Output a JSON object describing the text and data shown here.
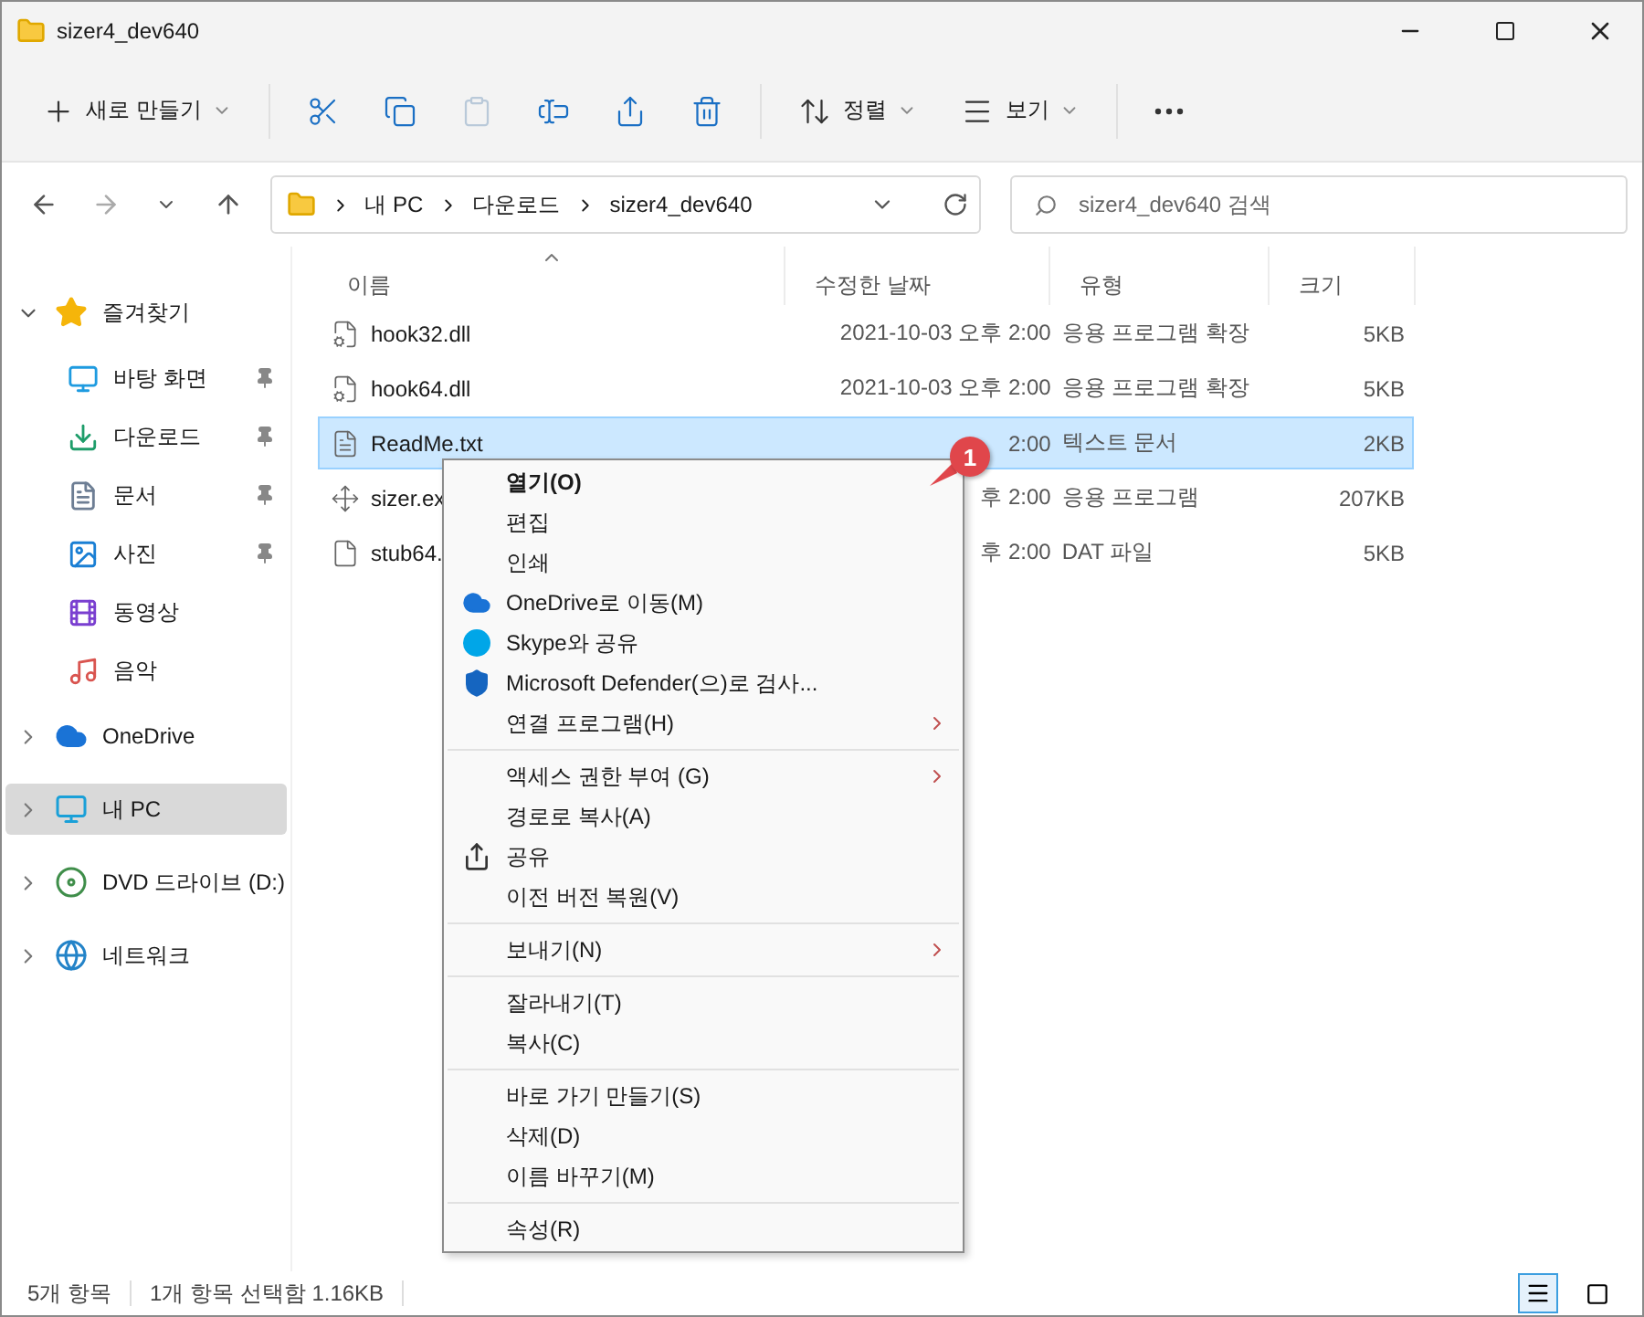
{
  "window": {
    "title": "sizer4_dev640"
  },
  "toolbar": [
    {
      "kind": "labeled",
      "label": "새로 만들기",
      "disabled": false
    },
    {
      "kind": "icon",
      "disabled": false
    },
    {
      "kind": "icon",
      "disabled": false
    },
    {
      "kind": "icon",
      "disabled": true
    },
    {
      "kind": "icon",
      "disabled": false
    },
    {
      "kind": "icon",
      "disabled": false
    },
    {
      "kind": "icon",
      "disabled": false
    },
    {
      "kind": "labeled",
      "label": "정렬",
      "disabled": false
    },
    {
      "kind": "labeled",
      "label": "보기",
      "disabled": false
    },
    {
      "kind": "icon",
      "disabled": false
    }
  ],
  "address": {
    "crumbs": [
      "내 PC",
      "다운로드",
      "sizer4_dev640"
    ]
  },
  "search": {
    "placeholder": "sizer4_dev640 검색"
  },
  "sidebar": [
    {
      "label": "즐겨찾기",
      "expanded": true,
      "selected": false,
      "children": [
        {
          "label": "바탕 화면",
          "pinned": true
        },
        {
          "label": "다운로드",
          "pinned": true
        },
        {
          "label": "문서",
          "pinned": true
        },
        {
          "label": "사진",
          "pinned": true
        },
        {
          "label": "동영상",
          "pinned": false
        },
        {
          "label": "음악",
          "pinned": false
        }
      ]
    },
    {
      "label": "OneDrive",
      "expanded": false,
      "selected": false
    },
    {
      "label": "내 PC",
      "expanded": false,
      "selected": true
    },
    {
      "label": "DVD 드라이브 (D:)",
      "expanded": false,
      "selected": false
    },
    {
      "label": "네트워크",
      "expanded": false,
      "selected": false
    }
  ],
  "table": {
    "columns": [
      {
        "label": "이름",
        "sorted": true
      },
      {
        "label": "수정한 날짜",
        "sorted": false
      },
      {
        "label": "유형",
        "sorted": false
      },
      {
        "label": "크기",
        "sorted": false
      }
    ],
    "rows": [
      {
        "name": "hook32.dll",
        "date": "2021-10-03 오후 2:00",
        "type": "응용 프로그램 확장",
        "size": "5KB",
        "selected": false
      },
      {
        "name": "hook64.dll",
        "date": "2021-10-03 오후 2:00",
        "type": "응용 프로그램 확장",
        "size": "5KB",
        "selected": false
      },
      {
        "name": "ReadMe.txt",
        "date": "2:00",
        "type": "텍스트 문서",
        "size": "2KB",
        "selected": true
      },
      {
        "name": "sizer.ex",
        "date": "후 2:00",
        "type": "응용 프로그램",
        "size": "207KB",
        "selected": false
      },
      {
        "name": "stub64.",
        "date": "후 2:00",
        "type": "DAT 파일",
        "size": "5KB",
        "selected": false
      }
    ]
  },
  "context_menu": [
    [
      {
        "label": "열기(O)",
        "default": true,
        "submenu": false
      },
      {
        "label": "편집",
        "default": false,
        "submenu": false
      },
      {
        "label": "인쇄",
        "default": false,
        "submenu": false
      },
      {
        "label": "OneDrive로 이동(M)",
        "default": false,
        "submenu": false
      },
      {
        "label": "Skype와 공유",
        "default": false,
        "submenu": false
      },
      {
        "label": "Microsoft Defender(으)로 검사...",
        "default": false,
        "submenu": false
      },
      {
        "label": "연결 프로그램(H)",
        "default": false,
        "submenu": true
      }
    ],
    [
      {
        "label": "액세스 권한 부여 (G)",
        "default": false,
        "submenu": true
      },
      {
        "label": "경로로 복사(A)",
        "default": false,
        "submenu": false
      },
      {
        "label": "공유",
        "default": false,
        "submenu": false
      },
      {
        "label": "이전 버전 복원(V)",
        "default": false,
        "submenu": false
      }
    ],
    [
      {
        "label": "보내기(N)",
        "default": false,
        "submenu": true
      }
    ],
    [
      {
        "label": "잘라내기(T)",
        "default": false,
        "submenu": false
      },
      {
        "label": "복사(C)",
        "default": false,
        "submenu": false
      }
    ],
    [
      {
        "label": "바로 가기 만들기(S)",
        "default": false,
        "submenu": false
      },
      {
        "label": "삭제(D)",
        "default": false,
        "submenu": false
      },
      {
        "label": "이름 바꾸기(M)",
        "default": false,
        "submenu": false
      }
    ],
    [
      {
        "label": "속성(R)",
        "default": false,
        "submenu": false
      }
    ]
  ],
  "callout": {
    "label": "1"
  },
  "status_bar": {
    "count": "5개 항목",
    "selection": "1개 항목 선택함 1.16KB"
  },
  "view_buttons": [
    {
      "selected": true
    },
    {
      "selected": false
    }
  ]
}
